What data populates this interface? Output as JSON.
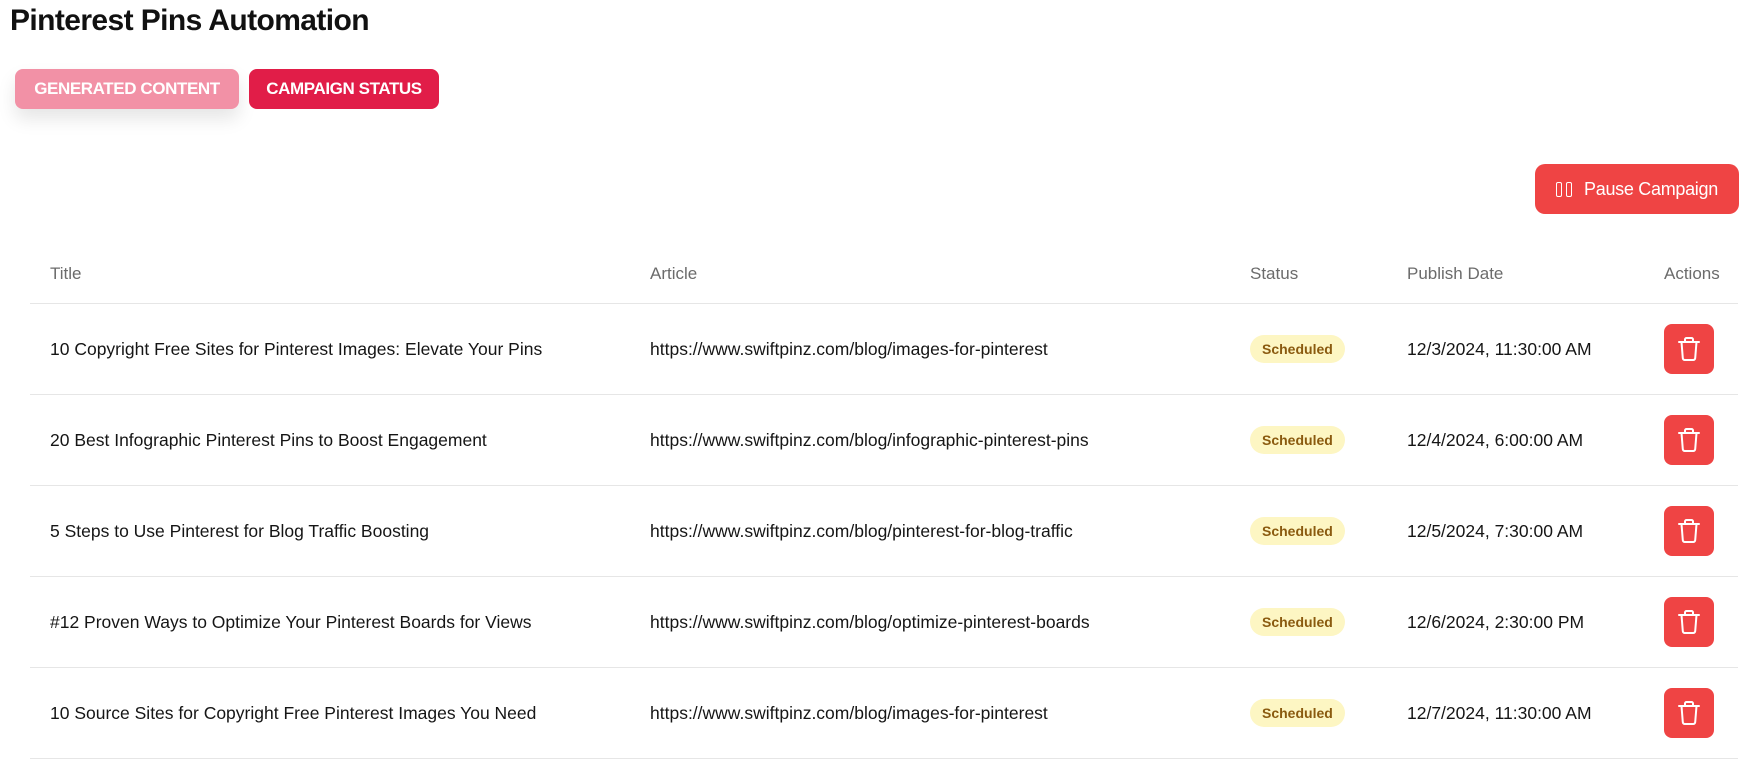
{
  "page": {
    "title": "Pinterest Pins Automation"
  },
  "tabs": [
    {
      "label": "GENERATED CONTENT"
    },
    {
      "label": "CAMPAIGN STATUS"
    }
  ],
  "toolbar": {
    "pause_label": "Pause Campaign"
  },
  "table": {
    "headers": [
      "Title",
      "Article",
      "Status",
      "Publish Date",
      "Actions"
    ],
    "rows": [
      {
        "title": "10 Copyright Free Sites for Pinterest Images: Elevate Your Pins",
        "article": "https://www.swiftpinz.com/blog/images-for-pinterest",
        "status": "Scheduled",
        "date": "12/3/2024, 11:30:00 AM"
      },
      {
        "title": "20 Best Infographic Pinterest Pins to Boost Engagement",
        "article": "https://www.swiftpinz.com/blog/infographic-pinterest-pins",
        "status": "Scheduled",
        "date": "12/4/2024, 6:00:00 AM"
      },
      {
        "title": "5 Steps to Use Pinterest for Blog Traffic Boosting",
        "article": "https://www.swiftpinz.com/blog/pinterest-for-blog-traffic",
        "status": "Scheduled",
        "date": "12/5/2024, 7:30:00 AM"
      },
      {
        "title": "#12 Proven Ways to Optimize Your Pinterest Boards for Views",
        "article": "https://www.swiftpinz.com/blog/optimize-pinterest-boards",
        "status": "Scheduled",
        "date": "12/6/2024, 2:30:00 PM"
      },
      {
        "title": "10 Source Sites for Copyright Free Pinterest Images You Need",
        "article": "https://www.swiftpinz.com/blog/images-for-pinterest",
        "status": "Scheduled",
        "date": "12/7/2024, 11:30:00 AM"
      }
    ]
  },
  "colors": {
    "accent": "#e11d48",
    "danger": "#ef4444",
    "tab_inactive": "#f291a6",
    "badge_bg": "#fdf6c3",
    "badge_text": "#8a5a0f"
  },
  "icons": {
    "pause": "pause-icon",
    "delete": "trash-icon"
  }
}
